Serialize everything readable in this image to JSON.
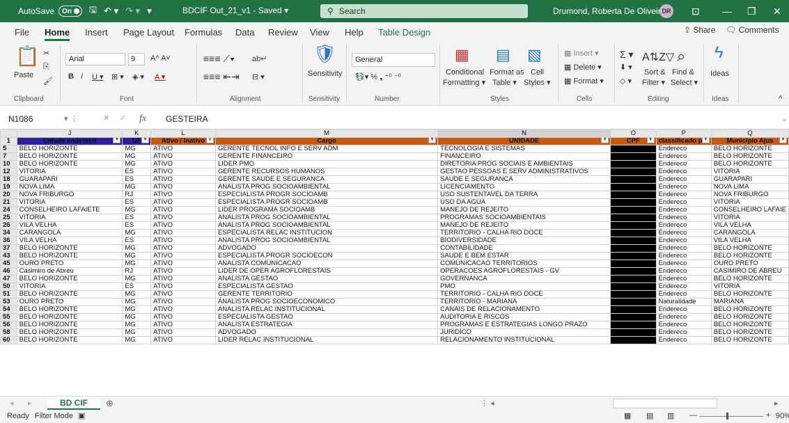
{
  "app": {
    "autosave_label": "AutoSave",
    "autosave_state": "On",
    "file_title": "BDCIF Out_21_v1 - Saved ▾",
    "search_label": "Search",
    "user_name": "Drumond, Roberta De Oliveira",
    "user_initials": "DR"
  },
  "menu": {
    "items": [
      "File",
      "Home",
      "Insert",
      "Page Layout",
      "Formulas",
      "Data",
      "Review",
      "View",
      "Help",
      "Table Design"
    ],
    "share": "Share",
    "comments": "Comments"
  },
  "ribbon": {
    "paste": "Paste",
    "font_name": "Arial",
    "font_size": "9",
    "sensitivity": "Sensitivity",
    "number_format": "General",
    "conditional": "Conditional",
    "formatting": "Formatting ▾",
    "format_as": "Format as",
    "table": "Table ▾",
    "cell": "Cell",
    "styles_btn": "Styles ▾",
    "insert": "Insert ▾",
    "delete": "Delete ▾",
    "format": "Format ▾",
    "sort": "Sort &",
    "filter": "Filter ▾",
    "find": "Find &",
    "select": "Select ▾",
    "ideas": "Ideas",
    "groups": [
      "Clipboard",
      "Font",
      "Alignment",
      "Sensitivity",
      "Number",
      "Styles",
      "Cells",
      "Editing",
      "Ideas"
    ]
  },
  "formula": {
    "name_box": "N1086",
    "fx": "fx",
    "value": "GESTEIRA"
  },
  "sheet": {
    "columns": [
      "J",
      "K",
      "L",
      "M",
      "N",
      "O",
      "P",
      "Q"
    ],
    "headers": [
      "Cidade endereco",
      "UF",
      "Ativo / Inativo",
      "Cargo",
      "UNIDADE",
      "CPF",
      "classificado por",
      "Municipio Ajus"
    ],
    "header_row": "1",
    "rows": [
      [
        "5",
        "BELO HORIZONTE",
        "MG",
        "ATIVO",
        "GERENTE TECNOL INFO E SERV ADM",
        "TECNOLOGIA E SISTEMAS",
        "",
        "Endereco",
        "BELO HORIZONTE"
      ],
      [
        "7",
        "BELO HORIZONTE",
        "MG",
        "ATIVO",
        "GERENTE FINANCEIRO",
        "FINANCEIRO",
        "",
        "Endereco",
        "BELO HORIZONTE"
      ],
      [
        "10",
        "BELO HORIZONTE",
        "MG",
        "ATIVO",
        "LIDER PMO",
        "DIRETORIA PROG SOCIAIS E AMBIENTAIS",
        "",
        "Endereco",
        "BELO HORIZONTE"
      ],
      [
        "12",
        "VITORIA",
        "ES",
        "ATIVO",
        "GERENTE RECURSOS HUMANOS",
        "GESTAO PESSOAS E SERV ADMINISTRATIVOS",
        "",
        "Endereco",
        "VITORIA"
      ],
      [
        "18",
        "GUARAPARI",
        "ES",
        "ATIVO",
        "GERENTE SAUDE E SEGURANCA",
        "SAUDE E SEGURANCA",
        "",
        "Endereco",
        "GUARAPARI"
      ],
      [
        "19",
        "NOVA LIMA",
        "MG",
        "ATIVO",
        "ANALISTA PROG SOCIOAMBIENTAL",
        "LICENCIAMENTO",
        "",
        "Endereco",
        "NOVA LIMA"
      ],
      [
        "20",
        "NOVA FRIBURGO",
        "RJ",
        "ATIVO",
        "ESPECIALISTA PROGR SOCIOAMB",
        "USO SUSTENTAVEL DA TERRA",
        "",
        "Endereco",
        "NOVA FRIBURGO"
      ],
      [
        "21",
        "VITORIA",
        "ES",
        "ATIVO",
        "ESPECIALISTA PROGR SOCIOAMB",
        "USO DA AGUA",
        "",
        "Endereco",
        "VITORIA"
      ],
      [
        "24",
        "CONSELHEIRO LAFAIETE",
        "MG",
        "ATIVO",
        "LIDER PROGRAMA SOCIOAMB",
        "MANEJO DE REJEITO",
        "",
        "Endereco",
        "CONSELHEIRO LAFAIE"
      ],
      [
        "25",
        "VITORIA",
        "ES",
        "ATIVO",
        "ANALISTA PROG SOCIOAMBIENTAL",
        "PROGRAMAS SOCIOAMBIENTAIS",
        "",
        "Endereco",
        "VITORIA"
      ],
      [
        "26",
        "VILA VELHA",
        "ES",
        "ATIVO",
        "ANALISTA PROG SOCIOAMBIENTAL",
        "MANEJO DE REJEITO",
        "",
        "Endereco",
        "VILA VELHA"
      ],
      [
        "34",
        "CARANGOLA",
        "MG",
        "ATIVO",
        "ESPECIALISTA RELAC INSTITUCION",
        "TERRITORIO - CALHA RIO DOCE",
        "",
        "Endereco",
        "CARANGOLA"
      ],
      [
        "36",
        "VILA VELHA",
        "ES",
        "ATIVO",
        "ANALISTA PROG SOCIOAMBIENTAL",
        "BIODIVERSIDADE",
        "",
        "Endereco",
        "VILA VELHA"
      ],
      [
        "37",
        "BELO HORIZONTE",
        "MG",
        "ATIVO",
        "ADVOGADO",
        "CONTABILIDADE",
        "",
        "Endereco",
        "BELO HORIZONTE"
      ],
      [
        "43",
        "BELO HORIZONTE",
        "MG",
        "ATIVO",
        "ESPECIALISTA PROGR SOCIOECON",
        "SAUDE E BEM ESTAR",
        "",
        "Endereco",
        "BELO HORIZONTE"
      ],
      [
        "45",
        "OURO PRETO",
        "MG",
        "ATIVO",
        "ANALISTA COMUNICACAO",
        "COMUNICACAO TERRITORIOS",
        "",
        "Endereco",
        "OURO PRETO"
      ],
      [
        "46",
        "Casimiro de Abreu",
        "RJ",
        "ATIVO",
        "LIDER DE OPER AGROFLORESTAIS",
        "OPERACOES AGROFLORESTAIS - GV",
        "",
        "Endereco",
        "CASIMIRO DE ABREU"
      ],
      [
        "47",
        "BELO HORIZONTE",
        "MG",
        "ATIVO",
        "ANALISTA GESTAO",
        "GOVERNANCA",
        "",
        "Endereco",
        "BELO HORIZONTE"
      ],
      [
        "50",
        "VITORIA",
        "ES",
        "ATIVO",
        "ESPECIALISTA GESTAO",
        "PMO",
        "",
        "Endereco",
        "VITORIA"
      ],
      [
        "51",
        "BELO HORIZONTE",
        "MG",
        "ATIVO",
        "GERENTE TERRITORIO",
        "TERRITORIO - CALHA RIO DOCE",
        "",
        "Endereco",
        "BELO HORIZONTE"
      ],
      [
        "53",
        "OURO PRETO",
        "MG",
        "ATIVO",
        "ANALISTA PROG SOCIOECONOMICO",
        "TERRITORIO - MARIANA",
        "",
        "Naturalidade",
        "MARIANA"
      ],
      [
        "54",
        "BELO HORIZONTE",
        "MG",
        "ATIVO",
        "ANALISTA RELAC INSTITUCIONAL",
        "CANAIS DE RELACIONAMENTO",
        "",
        "Endereco",
        "BELO HORIZONTE"
      ],
      [
        "55",
        "BELO HORIZONTE",
        "MG",
        "ATIVO",
        "ESPECIALISTA GESTAO",
        "AUDITORIA E RISCOS",
        "",
        "Endereco",
        "BELO HORIZONTE"
      ],
      [
        "56",
        "BELO HORIZONTE",
        "MG",
        "ATIVO",
        "ANALISTA ESTRATEGIA",
        "PROGRAMAS E ESTRATEGIAS LONGO PRAZO",
        "",
        "Endereco",
        "BELO HORIZONTE"
      ],
      [
        "58",
        "BELO HORIZONTE",
        "MG",
        "ATIVO",
        "ADVOGADO",
        "JURIDICO",
        "",
        "Endereco",
        "BELO HORIZONTE"
      ],
      [
        "60",
        "BELO HORIZONTE",
        "MG",
        "ATIVO",
        "LIDER RELAC INSTITUCIONAL",
        "RELACIONAMENTO INSTITUCIONAL",
        "",
        "Endereco",
        "BELO HORIZONTE"
      ]
    ]
  },
  "sheet_tab": "BD CIF",
  "status": {
    "ready": "Ready",
    "filter_mode": "Filter Mode",
    "zoom": "90%"
  }
}
